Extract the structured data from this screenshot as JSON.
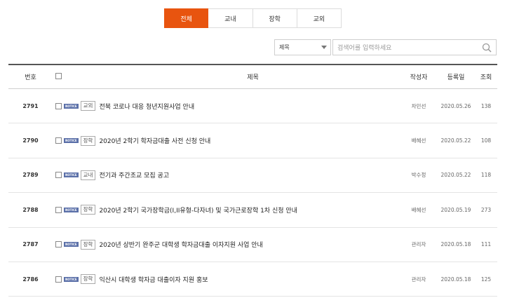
{
  "tabs": [
    {
      "label": "전체",
      "active": true
    },
    {
      "label": "교내",
      "active": false
    },
    {
      "label": "장학",
      "active": false
    },
    {
      "label": "교외",
      "active": false
    }
  ],
  "search": {
    "select_value": "제목",
    "placeholder": "검색어를 입력하세요"
  },
  "table": {
    "headers": {
      "no": "번호",
      "title": "제목",
      "author": "작성자",
      "date": "등록일",
      "views": "조회"
    },
    "notice_label": "NOTICE",
    "rows": [
      {
        "no": "2791",
        "category": "교외",
        "title": "전북 코로나 대응 청년지원사업 안내",
        "author": "차민선",
        "date": "2020.05.26",
        "views": "138"
      },
      {
        "no": "2790",
        "category": "장학",
        "title": "2020년 2학기 학자금대출 사전 신청 안내",
        "author": "배혜선",
        "date": "2020.05.22",
        "views": "108"
      },
      {
        "no": "2789",
        "category": "교내",
        "title": "전기과 주간조교 모집 공고",
        "author": "박수정",
        "date": "2020.05.22",
        "views": "118"
      },
      {
        "no": "2788",
        "category": "장학",
        "title": "2020년 2학기 국가장학금(I,II유형-다자녀) 및 국가근로장학 1차 신청 안내",
        "author": "배혜선",
        "date": "2020.05.19",
        "views": "273"
      },
      {
        "no": "2787",
        "category": "장학",
        "title": "2020년 상반기 완주군 대학생 학자금대출 이자지원 사업 안내",
        "author": "관리자",
        "date": "2020.05.18",
        "views": "111"
      },
      {
        "no": "2786",
        "category": "장학",
        "title": "익산시 대학생 학자금 대출이자 지원 홍보",
        "author": "관리자",
        "date": "2020.05.18",
        "views": "125"
      }
    ]
  }
}
